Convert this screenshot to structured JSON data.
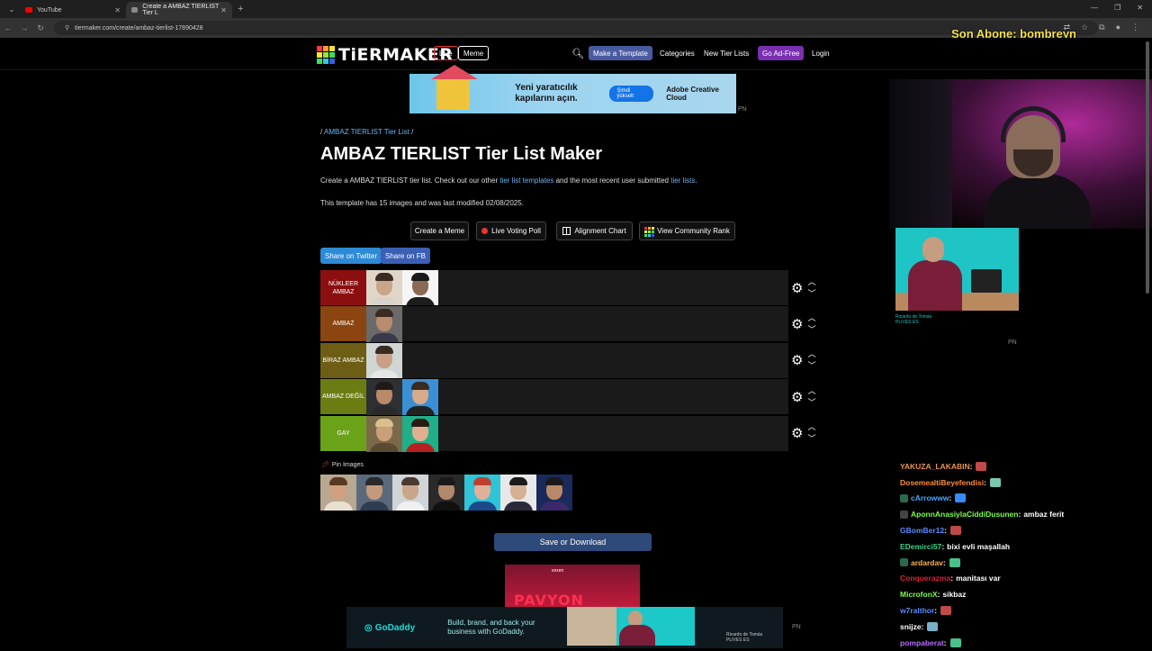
{
  "browser": {
    "tabs": [
      {
        "label": "YouTube",
        "active": false,
        "favicon_color": "#ff0000"
      },
      {
        "label": "Create a AMBAZ TIERLIST Tier L",
        "active": true,
        "favicon_color": "#8a8a8a"
      }
    ],
    "url": "tiermaker.com/create/ambaz-tierlist-17890428"
  },
  "stream_overlay": {
    "text": "Son Abone: bombreyn"
  },
  "site": {
    "logo_text": "TiERMAKER",
    "nav": {
      "live": "Live",
      "meme": "Meme",
      "make_template": "Make a Template",
      "categories": "Categories",
      "new_tier_lists": "New Tier Lists",
      "go_ad_free": "Go Ad-Free",
      "login": "Login"
    }
  },
  "ads": {
    "top": {
      "headline": "Yeni yaratıcılık kapılarını açın.",
      "button": "Şimdi yükselt",
      "brand": "Adobe Creative Cloud",
      "tag": "PN"
    },
    "mid": {
      "title": "PAVYON",
      "small": "exxen"
    },
    "bottom": {
      "brand": "GoDaddy",
      "text": "Build, brand, and back your business with GoDaddy.",
      "caption": "Ricardo de Tomás\nPLIVES ES",
      "tag": "PN"
    },
    "side": {
      "caption": "Ricardo de Tomás\nPLIVES ES",
      "tag": "PN"
    }
  },
  "page": {
    "breadcrumb_sep_1": "/",
    "breadcrumb": "AMBAZ TIERLIST Tier List",
    "breadcrumb_sep_2": "/",
    "title": "AMBAZ TIERLIST Tier List Maker",
    "desc_pre": "Create a AMBAZ TIERLIST tier list. Check out our other ",
    "desc_link1": "tier list templates",
    "desc_mid": " and the most recent user submitted ",
    "desc_link2": "tier lists",
    "desc_post": ".",
    "meta": "This template has 15 images and was last modified 02/08/2025.",
    "buttons": {
      "create_meme": "Create a Meme",
      "live_voting": "Live Voting Poll",
      "alignment": "Alignment Chart",
      "community_rank": "View Community Rank"
    },
    "share_twitter": "Share on Twitter",
    "share_fb": "Share on FB",
    "pin_images": "Pin Images",
    "save_download": "Save or Download"
  },
  "tiers": [
    {
      "label": "NÜKLEER AMBAZ",
      "color": "#8b0f0f",
      "item_count": 2
    },
    {
      "label": "AMBAZ",
      "color": "#8a4510",
      "item_count": 1
    },
    {
      "label": "BİRAZ AMBAZ",
      "color": "#6e5d14",
      "item_count": 1
    },
    {
      "label": "AMBAZ DEĞİL",
      "color": "#6b7d12",
      "item_count": 2
    },
    {
      "label": "GAY",
      "color": "#6aa318",
      "item_count": 2
    }
  ],
  "pool_count": 7,
  "chat": [
    {
      "user": "YAKUZA_LAKABIN",
      "color": "#e8944a",
      "msg": ""
    },
    {
      "user": "DosemealtiBeyefendisi",
      "color": "#ff8c3a",
      "msg": ""
    },
    {
      "user": "cArrowww",
      "color": "#4aa8ff",
      "msg": ""
    },
    {
      "user": "AponnAnasiylaCiddiDusunen",
      "color": "#7cff4a",
      "msg": "ambaz ferit"
    },
    {
      "user": "GBomBer12",
      "color": "#5c8cff",
      "msg": ""
    },
    {
      "user": "EDemirci57",
      "color": "#32d38a",
      "msg": "bixi evli maşallah"
    },
    {
      "user": "ardardav",
      "color": "#ffb347",
      "msg": ""
    },
    {
      "user": "Conquerazma",
      "color": "#e0203a",
      "msg": "manitası var"
    },
    {
      "user": "MicrofonX",
      "color": "#7cff4a",
      "msg": "sikbaz"
    },
    {
      "user": "w7ralthor",
      "color": "#5c8cff",
      "msg": ""
    },
    {
      "user": "snijze",
      "color": "#ffffff",
      "msg": ""
    },
    {
      "user": "pompaberat",
      "color": "#b76cff",
      "msg": ""
    }
  ]
}
